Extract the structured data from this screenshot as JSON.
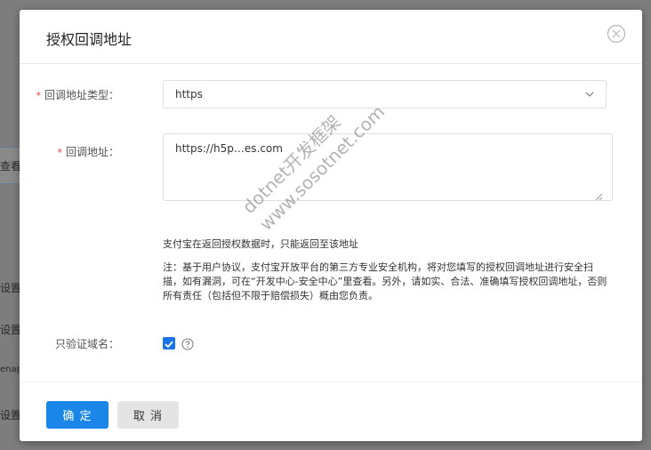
{
  "background": {
    "fragments": [
      "设置",
      "设置",
      "enap",
      "设置"
    ],
    "tab_fragment": "查看"
  },
  "dialog": {
    "title": "授权回调地址",
    "fields": {
      "callback_type": {
        "label": "回调地址类型：",
        "required_mark": "*",
        "value": "https"
      },
      "callback_url": {
        "label": "回调地址：",
        "required_mark": "*",
        "value": "https://h5p…es.com"
      },
      "verify_domain": {
        "label": "只验证域名：",
        "checked": true
      }
    },
    "hint": "支付宝在返回授权数据时，只能返回至该地址",
    "note": "注：基于用户协议，支付宝开放平台的第三方专业安全机构，将对您填写的授权回调地址进行安全扫描，如有漏洞，可在“开发中心-安全中心”里查看。另外，请如实、合法、准确填写授权回调地址，否则所有责任（包括但不限于赔偿损失）概由您负责。",
    "buttons": {
      "confirm": "确 定",
      "cancel": "取 消"
    }
  },
  "watermark": {
    "line1": "dotnet开发框架",
    "line2": "www.sosotnet.com"
  },
  "colors": {
    "primary": "#1a86e8",
    "required": "#e03b3b",
    "overlay": "#7d7d7d"
  }
}
